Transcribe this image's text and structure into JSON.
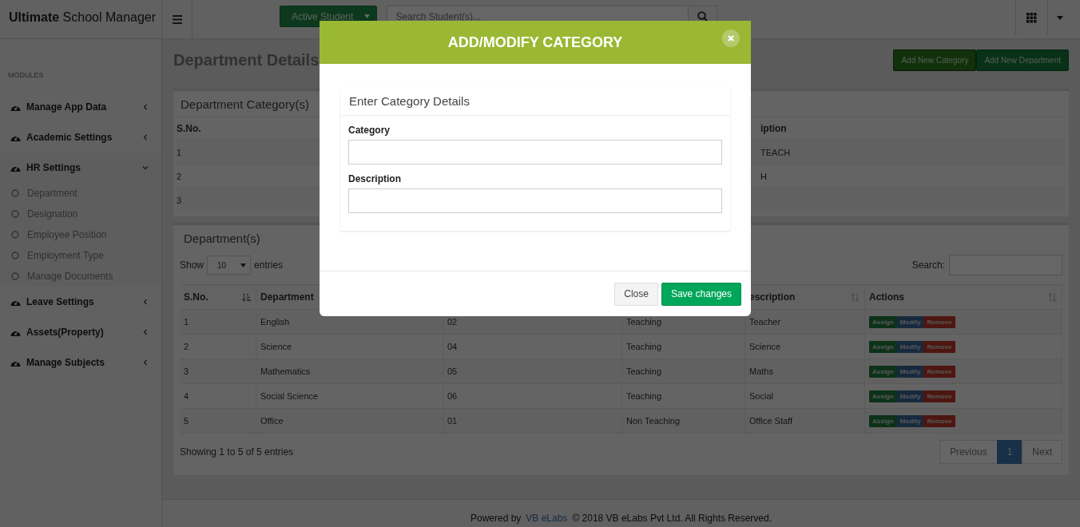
{
  "brand": {
    "bold": "Ultimate",
    "rest": "School Manager"
  },
  "topbar": {
    "active_button": "Active Student",
    "search": {
      "placeholder": "Search Student(s)..."
    }
  },
  "sidebar": {
    "heading": "MODULES",
    "items": [
      {
        "label": "Manage App Data",
        "expanded": false
      },
      {
        "label": "Academic Settings",
        "expanded": false
      },
      {
        "label": "HR Settings",
        "expanded": true,
        "children": [
          {
            "label": "Department"
          },
          {
            "label": "Designation"
          },
          {
            "label": "Employee Position"
          },
          {
            "label": "Employment Type"
          },
          {
            "label": "Manage Documents"
          }
        ]
      },
      {
        "label": "Leave Settings",
        "expanded": false
      },
      {
        "label": "Assets(Property)",
        "expanded": false
      },
      {
        "label": "Manage Subjects",
        "expanded": false
      }
    ]
  },
  "page_title": "Department Details",
  "header_buttons": [
    {
      "label": "Add New Category",
      "selected": true
    },
    {
      "label": "Add New Department",
      "selected": false
    }
  ],
  "category_panel": {
    "title": "Department Category(s)",
    "columns": {
      "s_no": "S.No.",
      "description": "iption"
    },
    "rows": [
      {
        "s_no": "1",
        "description": "TEACH"
      },
      {
        "s_no": "2",
        "description": "H"
      },
      {
        "s_no": "3"
      }
    ]
  },
  "department_panel": {
    "title": "Department(s)",
    "length": {
      "before": "Show",
      "value": "10",
      "after": "entries"
    },
    "search_label": "Search:",
    "columns": {
      "s_no": "S.No.",
      "department": "Department",
      "description": "escription",
      "actions": "Actions"
    },
    "rows": [
      {
        "s_no": "1",
        "department": "English",
        "code": "02",
        "type": "Teaching",
        "description": "Teacher",
        "actions": [
          {
            "label": "Assign",
            "kind": "assign"
          },
          {
            "label": "Modify",
            "kind": "modify"
          },
          {
            "label": "Remove",
            "kind": "remove"
          }
        ]
      },
      {
        "s_no": "2",
        "department": "Science",
        "code": "04",
        "type": "Teaching",
        "description": "Science",
        "actions": [
          {
            "label": "Assign",
            "kind": "assign"
          },
          {
            "label": "Modify",
            "kind": "modify"
          },
          {
            "label": "Remove",
            "kind": "remove"
          }
        ]
      },
      {
        "s_no": "3",
        "department": "Mathematics",
        "code": "05",
        "type": "Teaching",
        "description": "Maths",
        "actions": [
          {
            "label": "Assign",
            "kind": "assign"
          },
          {
            "label": "Modify",
            "kind": "modify"
          },
          {
            "label": "Remove",
            "kind": "remove"
          }
        ]
      },
      {
        "s_no": "4",
        "department": "Social Science",
        "code": "06",
        "type": "Teaching",
        "description": "Social",
        "actions": [
          {
            "label": "Assign",
            "kind": "assign"
          },
          {
            "label": "Modify",
            "kind": "modify"
          },
          {
            "label": "Remove",
            "kind": "remove"
          }
        ]
      },
      {
        "s_no": "5",
        "department": "Office",
        "code": "01",
        "type": "Non Teaching",
        "description": "Office Staff",
        "actions": [
          {
            "label": "Assign",
            "kind": "assign"
          },
          {
            "label": "Modify",
            "kind": "modify"
          },
          {
            "label": "Remove",
            "kind": "remove"
          }
        ]
      }
    ],
    "info": "Showing 1 to 5 of 5 entries",
    "pagination": [
      {
        "label": "Previous",
        "selected": false
      },
      {
        "label": "1",
        "selected": true
      },
      {
        "label": "Next",
        "selected": false
      }
    ]
  },
  "footer": {
    "powered_by": "Powered by",
    "link": "VB eLabs",
    "copyright": "© 2018 VB eLabs Pvt Ltd. All Rights Reserved."
  },
  "modal": {
    "title": "ADD/MODIFY CATEGORY",
    "section_title": "Enter Category Details",
    "fields": [
      {
        "label": "Category"
      },
      {
        "label": "Description"
      }
    ],
    "buttons": [
      {
        "label": "Close",
        "kind": "default"
      },
      {
        "label": "Save changes",
        "kind": "primary"
      }
    ]
  }
}
